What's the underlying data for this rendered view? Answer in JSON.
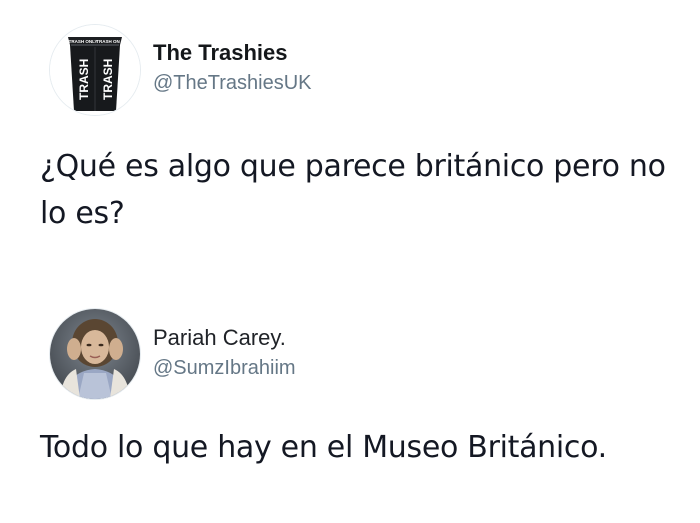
{
  "tweets": [
    {
      "author": {
        "display_name": "The Trashies",
        "handle": "@TheTrashiesUK",
        "avatar_icon": "trash-bin-icon",
        "avatar_text": {
          "top_left": "TRASH ONLY",
          "top_right": "TRASH ON",
          "left_side": "TRASH",
          "right_side": "TRASH"
        }
      },
      "text": "¿Qué es algo que parece británico pero no lo es?"
    },
    {
      "author": {
        "display_name": "Pariah Carey.",
        "handle": "@SumzIbrahiim",
        "avatar_icon": "profile-photo-icon"
      },
      "text": "Todo lo que hay en el Museo Británico."
    }
  ],
  "colors": {
    "background": "#ffffff",
    "text": "#141823",
    "secondary_text": "#657786"
  }
}
